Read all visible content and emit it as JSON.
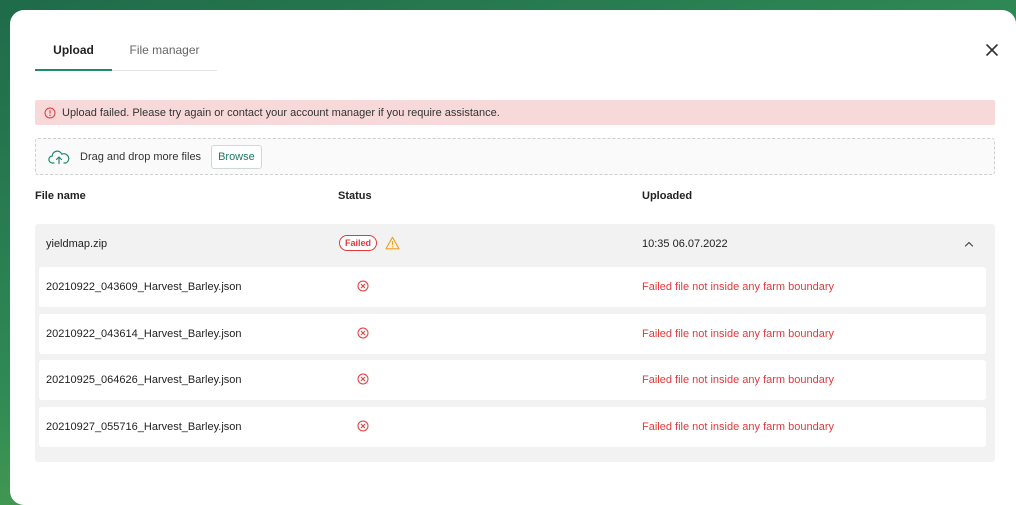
{
  "tabs": [
    {
      "label": "Upload",
      "active": true
    },
    {
      "label": "File manager",
      "active": false
    }
  ],
  "alert": {
    "text": "Upload failed. Please try again or contact your account manager if you require assistance.",
    "color": "#f7d9d9"
  },
  "dropzone": {
    "text": "Drag and drop more files",
    "browse_label": "Browse"
  },
  "table": {
    "headers": [
      "File name",
      "Status",
      "Uploaded"
    ],
    "group": {
      "name": "yieldmap.zip",
      "status": "Failed",
      "uploaded": "10:35 06.07.2022",
      "expanded": true
    },
    "rows": [
      {
        "name": "20210922_043609_Harvest_Barley.json",
        "message": "Failed file not inside any farm boundary"
      },
      {
        "name": "20210922_043614_Harvest_Barley.json",
        "message": "Failed file not inside any farm boundary"
      },
      {
        "name": "20210925_064626_Harvest_Barley.json",
        "message": "Failed file not inside any farm boundary"
      },
      {
        "name": "20210927_055716_Harvest_Barley.json",
        "message": "Failed file not inside any farm boundary"
      }
    ]
  },
  "colors": {
    "accent": "#1f8a6c",
    "error": "#e03a3a",
    "warning": "#f0a020"
  }
}
